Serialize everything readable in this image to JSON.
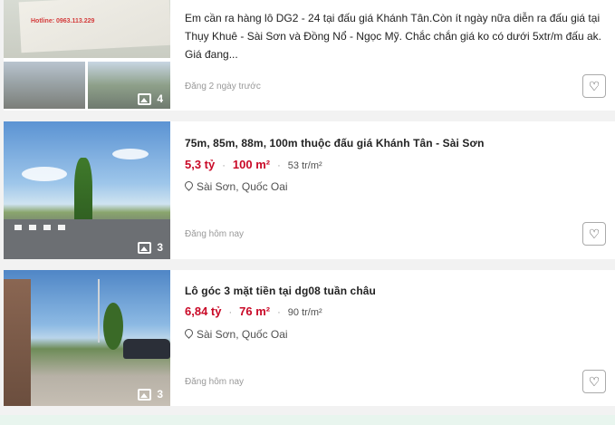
{
  "listings": [
    {
      "description": "Em cần ra hàng lô DG2 - 24 tại đấu giá Khánh Tân.Còn ít ngày nữa diễn ra đấu giá tại Thụy Khuê - Sài Sơn và Đồng Nổ - Ngọc Mỹ. Chắc chắn giá ko có dưới 5xtr/m đấu ak. Giá đang...",
      "posted": "Đăng 2 ngày trước",
      "photo_count": "4",
      "doc_text": "Hotline: 0963.113.229"
    },
    {
      "title": "75m, 85m, 88m, 100m thuộc đấu giá Khánh Tân - Sài Sơn",
      "price": "5,3 tỷ",
      "area": "100 m²",
      "price_per_m2": "53 tr/m²",
      "location": "Sài Sơn, Quốc Oai",
      "posted": "Đăng hôm nay",
      "photo_count": "3"
    },
    {
      "title": "Lô góc 3 mặt tiền tại dg08 tuần châu",
      "price": "6,84 tỷ",
      "area": "76 m²",
      "price_per_m2": "90 tr/m²",
      "location": "Sài Sơn, Quốc Oai",
      "posted": "Đăng hôm nay",
      "photo_count": "3"
    }
  ],
  "icons": {
    "save": "heart-outline-icon",
    "photos": "image-gallery-icon",
    "location": "map-pin-icon"
  },
  "colors": {
    "price_red": "#c90927",
    "muted": "#999999",
    "background": "#f2f2f2"
  },
  "separator": "·",
  "heart_glyph": "♡"
}
